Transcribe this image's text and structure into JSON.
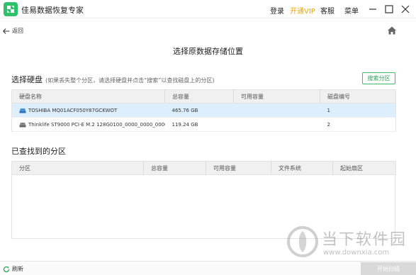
{
  "app": {
    "title": "佳易数据恢复专家",
    "brand_color": "#2ec06a"
  },
  "titlebar": {
    "login": "登录",
    "vip": "开通VIP",
    "service": "客服",
    "menu": "菜单",
    "vip_color": "#f0a500"
  },
  "nav": {
    "back_label": "返回"
  },
  "page": {
    "title": "选择原数据存储位置"
  },
  "disks": {
    "heading": "选择硬盘",
    "hint": "(如果丢失整个分区，请选择硬盘并点击“搜索”以查找磁盘上的分区)",
    "search_button": "搜索分区",
    "columns": [
      "硬盘名称",
      "总容量",
      "可用容量",
      "磁盘编号"
    ],
    "rows": [
      {
        "name": "TOSHIBA MQ01ACF050Y87GCKWOT",
        "total": "465.76 GB",
        "free": "",
        "index": "1",
        "selected": true
      },
      {
        "name": "Thinklife ST9000 PCI-E M.2 128G0100_0000_0000_0000.",
        "total": "119.24 GB",
        "free": "",
        "index": "2",
        "selected": false
      }
    ]
  },
  "partitions": {
    "heading": "已查找到的分区",
    "columns": [
      "分区",
      "总容量",
      "可用容量",
      "文件系统",
      "起始扇区"
    ]
  },
  "footer": {
    "refresh_label": "刷新",
    "start_button": "开始扫描"
  },
  "watermark": {
    "text": "当下软件园",
    "url": "www.downxia.com"
  }
}
